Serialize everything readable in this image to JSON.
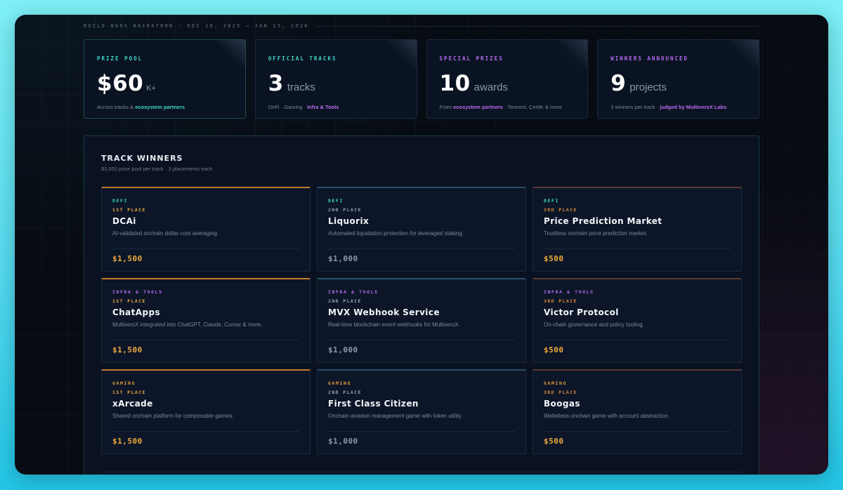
{
  "header": {
    "event_line": "BUILD WARS HACKATHON · DEC 16, 2025 – JAN 13, 2026"
  },
  "stats": [
    {
      "caption": "PRIZE POOL",
      "number": "$60",
      "unit": "K+",
      "desc_prefix": "Across tracks & ",
      "desc_highlight": "ecosystem partners",
      "desc_suffix": ""
    },
    {
      "caption": "OFFICIAL TRACKS",
      "number": "3",
      "unit": "tracks",
      "desc_prefix": "DeFi · Gaming · ",
      "desc_highlight": "Infra & Tools",
      "desc_suffix": ""
    },
    {
      "caption": "SPECIAL PRIZES",
      "number": "10",
      "unit": "awards",
      "desc_prefix": "From ",
      "desc_highlight": "ecosystem partners",
      "desc_suffix": " · Tencent, CertiK & more"
    },
    {
      "caption": "WINNERS ANNOUNCED",
      "number": "9",
      "unit": "projects",
      "desc_prefix": "3 winners per track · ",
      "desc_highlight": "judged by MultiversX Labs",
      "desc_suffix": ""
    }
  ],
  "panel": {
    "title": "TRACK WINNERS",
    "subtitle": "$3,000 prize pool per track · 3 placements each"
  },
  "winners": [
    {
      "track": "DEFI",
      "place": "1ST PLACE",
      "name": "DCAi",
      "desc": "AI-validated onchain dollar-cost averaging.",
      "amount": "$1,500"
    },
    {
      "track": "DEFI",
      "place": "2ND PLACE",
      "name": "Liquorix",
      "desc": "Automated liquidation protection for leveraged staking.",
      "amount": "$1,000"
    },
    {
      "track": "DEFI",
      "place": "3RD PLACE",
      "name": "Price Prediction Market",
      "desc": "Trustless onchain price prediction market.",
      "amount": "$500"
    },
    {
      "track": "INFRA & TOOLS",
      "place": "1ST PLACE",
      "name": "ChatApps",
      "desc": "MultiversX integrated into ChatGPT, Claude, Cursor & more.",
      "amount": "$1,500"
    },
    {
      "track": "INFRA & TOOLS",
      "place": "2ND PLACE",
      "name": "MVX Webhook Service",
      "desc": "Real-time blockchain event webhooks for MultiversX.",
      "amount": "$1,000"
    },
    {
      "track": "INFRA & TOOLS",
      "place": "3RD PLACE",
      "name": "Victor Protocol",
      "desc": "On-chain governance and policy tooling.",
      "amount": "$500"
    },
    {
      "track": "GAMING",
      "place": "1ST PLACE",
      "name": "xArcade",
      "desc": "Shared onchain platform for composable games.",
      "amount": "$1,500"
    },
    {
      "track": "GAMING",
      "place": "2ND PLACE",
      "name": "First Class Citizen",
      "desc": "Onchain aviation management game with token utility.",
      "amount": "$1,000"
    },
    {
      "track": "GAMING",
      "place": "3RD PLACE",
      "name": "Boogas",
      "desc": "Walletless onchain game with account abstraction.",
      "amount": "$500"
    }
  ],
  "colors": {
    "teal": "#3fd6c6",
    "purple": "#b86bf0",
    "gold": "#f0a93c",
    "background": "#070b12"
  }
}
